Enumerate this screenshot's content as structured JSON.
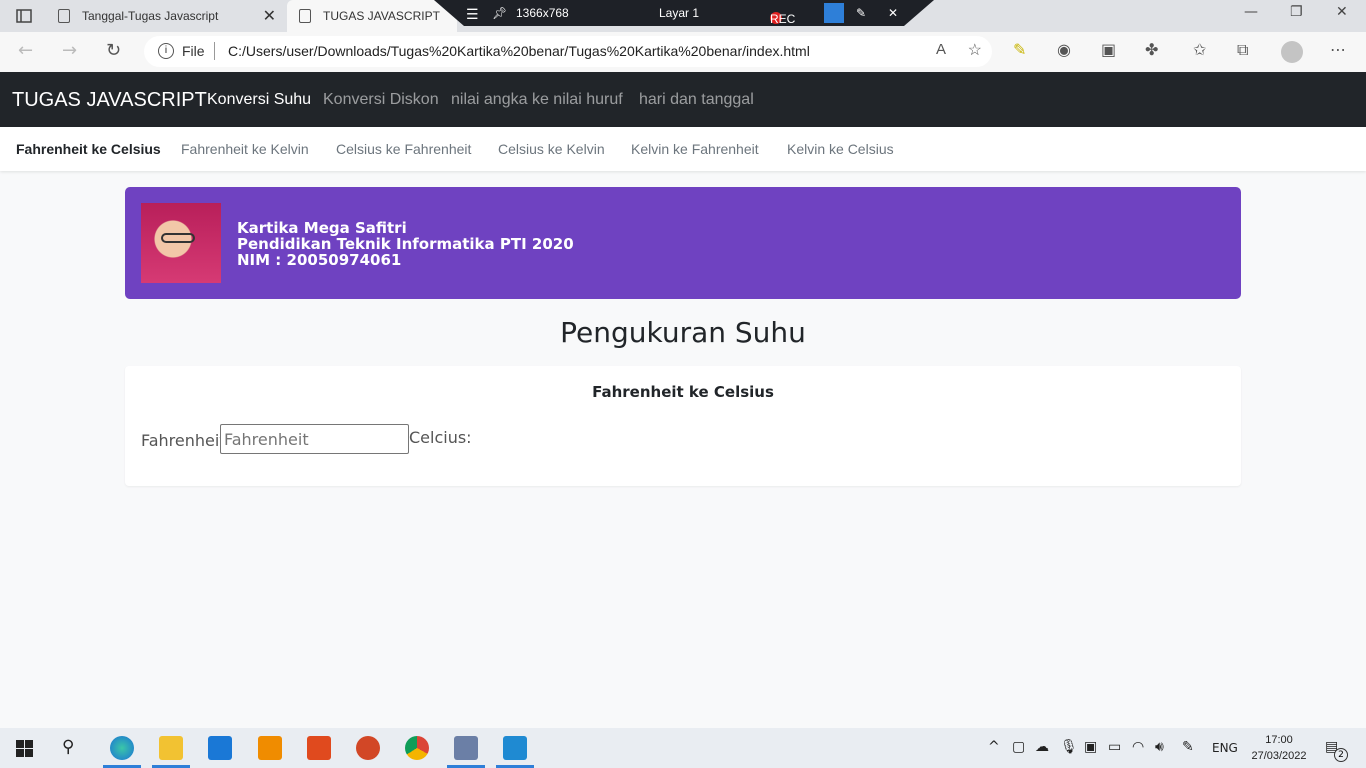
{
  "browser": {
    "tabs": [
      {
        "title": "Tanggal-Tugas Javascript"
      },
      {
        "title": "TUGAS JAVASCRIPT"
      }
    ],
    "recorder": {
      "size": "1366x768",
      "layer": "Layar 1",
      "rec_label": "REC"
    },
    "address": {
      "scheme_label": "File",
      "url": "C:/Users/user/Downloads/Tugas%20Kartika%20benar/Tugas%20Kartika%20benar/index.html"
    }
  },
  "navbar": {
    "brand": "TUGAS JAVASCRIPT",
    "links": [
      "Konversi Suhu",
      "Konversi Diskon",
      "nilai angka ke nilai huruf",
      "hari dan tanggal"
    ]
  },
  "subnav": {
    "links": [
      "Fahrenheit ke Celsius",
      "Fahrenheit ke Kelvin",
      "Celsius ke Fahrenheit",
      "Celsius ke Kelvin",
      "Kelvin ke Fahrenheit",
      "Kelvin ke Celsius"
    ]
  },
  "profile": {
    "name": "Kartika Mega Safitri",
    "program": "Pendidikan Teknik Informatika PTI 2020",
    "nim": "NIM : 20050974061",
    "bg_color": "#6f42c1"
  },
  "main": {
    "heading": "Pengukuran Suhu",
    "card_title": "Fahrenheit ke Celsius",
    "input_label": "Fahrenheit",
    "input_placeholder": "Fahrenheit",
    "input_value": "",
    "output_label": "Celcius:"
  },
  "taskbar": {
    "language": "ENG",
    "time": "17:00",
    "date": "27/03/2022",
    "notifications": "2"
  }
}
